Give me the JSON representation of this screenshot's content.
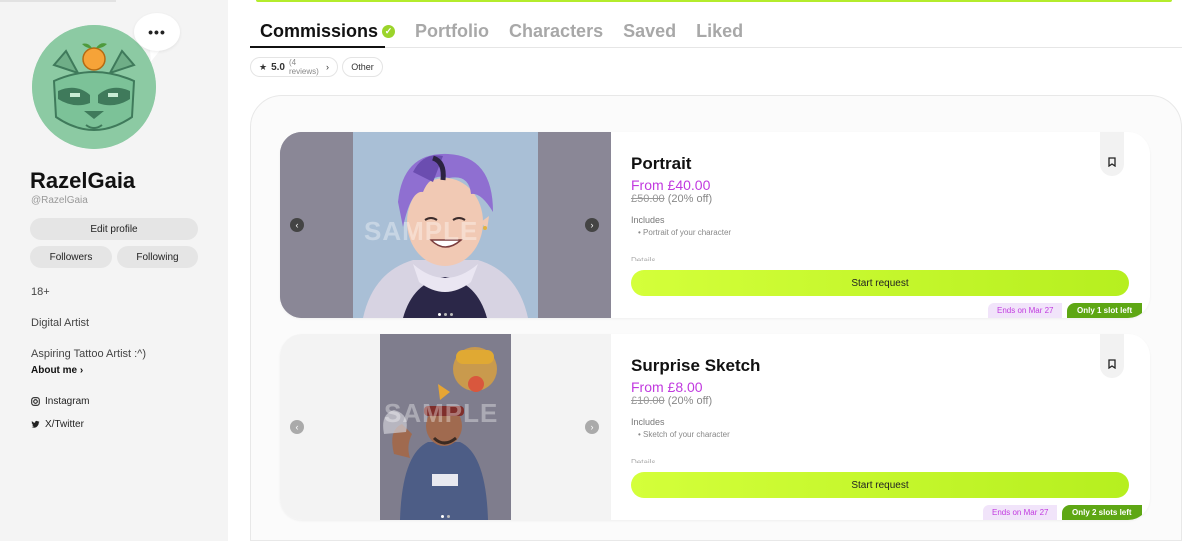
{
  "colors": {
    "accent_lime": "#b4ec2c",
    "price_purple": "#c13adf",
    "slots_green": "#5ea714",
    "avatar_bg": "#8ccaa3"
  },
  "profile": {
    "more_label": "•••",
    "username": "RazelGaia",
    "handle": "@RazelGaia",
    "edit_profile": "Edit profile",
    "followers": "Followers",
    "following": "Following",
    "age": "18+",
    "role": "Digital Artist",
    "bio": "Aspiring Tattoo Artist :^)",
    "about_me": "About me",
    "socials": [
      {
        "label": "Instagram",
        "icon": "instagram-icon"
      },
      {
        "label": "X/Twitter",
        "icon": "twitter-icon"
      }
    ]
  },
  "tabs": [
    {
      "label": "Commissions",
      "active": true
    },
    {
      "label": "Portfolio"
    },
    {
      "label": "Characters"
    },
    {
      "label": "Saved"
    },
    {
      "label": "Liked"
    }
  ],
  "filters": {
    "rating": "5.0",
    "reviews": "(4 reviews)",
    "other": "Other"
  },
  "listings": [
    {
      "title": "Portrait",
      "price": "From £40.00",
      "old_price": "£50.00",
      "discount": "(20% off)",
      "includes_label": "Includes",
      "includes_item": "Portrait of your character",
      "details_label": "Details",
      "button": "Start request",
      "ends": "Ends on Mar 27",
      "slots": "Only 1 slot left",
      "watermark": "SAMPLE"
    },
    {
      "title": "Surprise Sketch",
      "price": "From £8.00",
      "old_price": "£10.00",
      "discount": "(20% off)",
      "includes_label": "Includes",
      "includes_item": "Sketch of your character",
      "details_label": "Details",
      "button": "Start request",
      "ends": "Ends on Mar 27",
      "slots": "Only 2 slots left",
      "watermark": "SAMPLE"
    }
  ]
}
